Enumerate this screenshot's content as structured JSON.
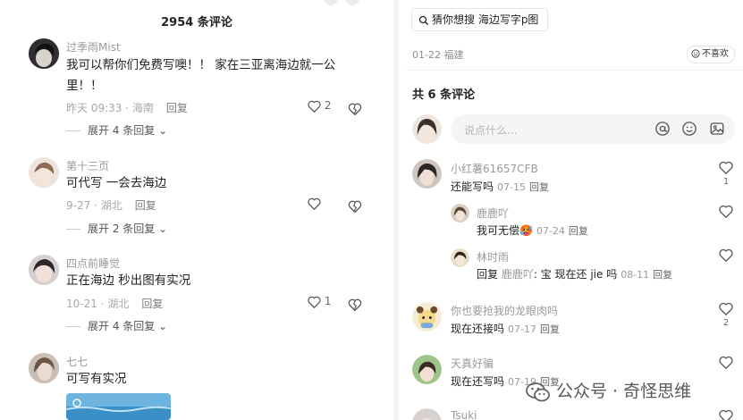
{
  "left": {
    "title": "2954 条评论",
    "comments": [
      {
        "user": "过季雨Mist",
        "text": "我可以帮你们免费写噢！！ 家在三亚离海边就一公里！！",
        "date": "昨天 09:33 · 海南",
        "reply": "回复",
        "likes": "2",
        "expand": "展开 4 条回复"
      },
      {
        "user": "第十三页",
        "text": "可代写 一会去海边",
        "date": "9-27 · 湖北",
        "reply": "回复",
        "likes": "",
        "expand": "展开 2 条回复"
      },
      {
        "user": "四点前睡觉",
        "text": "正在海边 秒出图有实况",
        "date": "10-21 · 湖北",
        "reply": "回复",
        "likes": "1",
        "expand": "展开 4 条回复"
      },
      {
        "user": "七七",
        "text": "可写有实况"
      }
    ]
  },
  "right": {
    "search_chip": "猜你想搜  海边写字p图",
    "post_date": "01-22 福建",
    "dislike_label": "不喜欢",
    "total": "共 6 条评论",
    "input_placeholder": "说点什么...",
    "comments": [
      {
        "user": "小红薯61657CFB",
        "text": "还能写吗",
        "date": "07-15",
        "reply": "回复",
        "likes": "1"
      },
      {
        "user": "鹿鹿吖",
        "text": "我可无偿🥵",
        "date": "07-24",
        "reply": "回复",
        "likes": ""
      },
      {
        "user": "林时雨",
        "text_prefix": "回复 ",
        "mention": "鹿鹿吖",
        "text": ": 宝 现在还 jie 吗",
        "date": "08-11",
        "reply": "回复",
        "likes": ""
      },
      {
        "user": "你也要抢我的龙眼肉吗",
        "text": "现在还接吗",
        "date": "07-17",
        "reply": "回复",
        "likes": "2"
      },
      {
        "user": "天真好骗",
        "text": "现在还写吗",
        "date": "07-19",
        "reply": "回复",
        "likes": ""
      },
      {
        "user": "Tsuki"
      }
    ]
  },
  "watermark": "公众号 · 奇怪思维"
}
